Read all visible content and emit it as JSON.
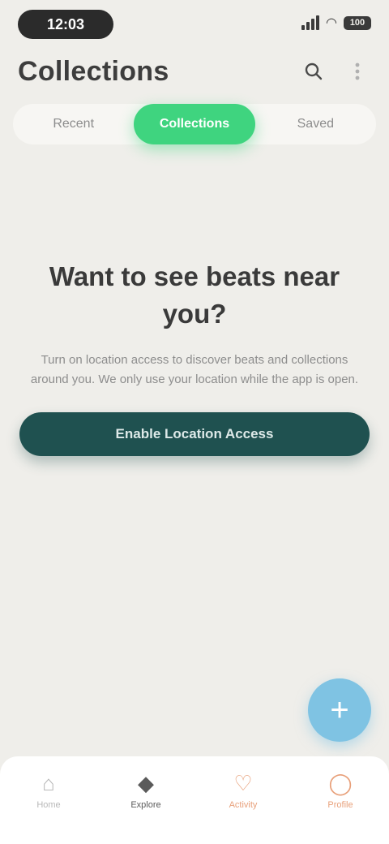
{
  "status_bar": {
    "time": "12:03",
    "battery": "100"
  },
  "header": {
    "title": "Collections",
    "search_icon": "search-icon",
    "more_icon": "more-icon"
  },
  "tabs": [
    {
      "label": "Recent",
      "active": false
    },
    {
      "label": "Collections",
      "active": true
    },
    {
      "label": "Saved",
      "active": false
    }
  ],
  "empty_state": {
    "title": "Want to see beats near you?",
    "description": "Turn on location access to discover beats and collections around you. We only use your location while the app is open.",
    "cta_label": "Enable Location Access"
  },
  "fab": {
    "icon": "plus-icon"
  },
  "bottom_nav": [
    {
      "label": "Home",
      "icon": "home-icon",
      "state": "default"
    },
    {
      "label": "Explore",
      "icon": "explore-icon",
      "state": "active"
    },
    {
      "label": "Activity",
      "icon": "heart-icon",
      "state": "accent"
    },
    {
      "label": "Profile",
      "icon": "profile-icon",
      "state": "accent"
    }
  ],
  "colors": {
    "background": "#efeeea",
    "tab_active": "#3fd47f",
    "cta": "#1f5150",
    "fab": "#7fc3e3"
  }
}
